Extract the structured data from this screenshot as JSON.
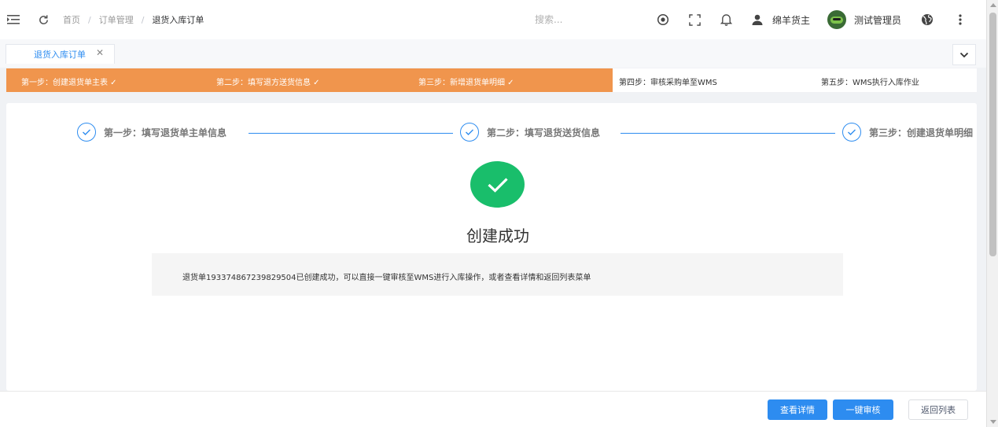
{
  "navbar": {
    "breadcrumb": [
      "首页",
      "订单管理",
      "退货入库订单"
    ],
    "breadcrumb_separator": "/",
    "search_placeholder": "搜索...",
    "owner_label": "绵羊货主",
    "user_label": "测试管理员",
    "icons": [
      "menu-icon",
      "refresh-icon",
      "record-icon",
      "fullscreen-icon",
      "bell-icon",
      "user-icon",
      "globe-icon",
      "more-vertical-icon"
    ]
  },
  "tabs": {
    "active_tab_label": "退货入库订单",
    "close_glyph": "✕"
  },
  "progress": {
    "steps": [
      {
        "label": "第一步：创建退货单主表 ✓",
        "done": true
      },
      {
        "label": "第二步：填写退方送货信息 ✓",
        "done": true
      },
      {
        "label": "第三步：新增退货单明细 ✓",
        "done": true
      },
      {
        "label": "第四步：审核采购单至WMS",
        "done": false
      },
      {
        "label": "第五步：WMS执行入库作业",
        "done": false
      }
    ],
    "done_color": "#f0954d"
  },
  "steps": [
    {
      "title": "第一步：填写退货单主单信息"
    },
    {
      "title": "第二步：填写退货送货信息"
    },
    {
      "title": "第三步：创建退货单明细"
    }
  ],
  "result": {
    "title": "创建成功",
    "description": "退货单1933748672398295​04已创建成功，可以直接一键审核至WMS进行入库操作，或者查看详情和返回列表菜单",
    "status_color": "#19be6b"
  },
  "footer": {
    "view_detail": "查看详情",
    "one_click_audit": "一键审核",
    "back_to_list": "返回列表"
  },
  "accent_color": "#2d8cf0"
}
